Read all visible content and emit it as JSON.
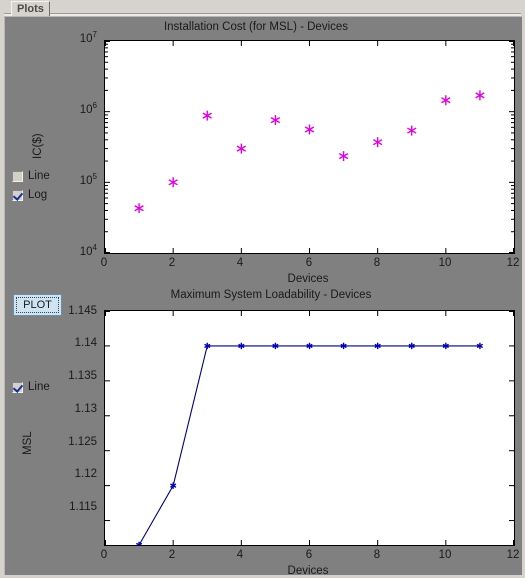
{
  "window": {
    "tab_label": "Plots",
    "background_color": "#808080",
    "frame_color": "#d6d3ce"
  },
  "controls": {
    "top": [
      {
        "name": "line",
        "label": "Line",
        "checked": false
      },
      {
        "name": "log",
        "label": "Log",
        "checked": true
      }
    ],
    "bottom": [
      {
        "name": "line",
        "label": "Line",
        "checked": true
      }
    ],
    "plot_button_label": "PLOT"
  },
  "chart_data": [
    {
      "id": "installation-cost",
      "type": "scatter",
      "title": "Installation Cost (for MSL) - Devices",
      "xlabel": "Devices",
      "ylabel": "IC($)",
      "yscale": "log",
      "xlim": [
        0,
        12
      ],
      "ylim": [
        10000,
        10000000
      ],
      "xticks": [
        0,
        2,
        4,
        6,
        8,
        10,
        12
      ],
      "xtick_labels": [
        "0",
        "2",
        "4",
        "6",
        "8",
        "10",
        "12"
      ],
      "yticks": [
        10000,
        100000,
        1000000,
        10000000
      ],
      "ytick_labels": [
        "10⁴",
        "10⁵",
        "10⁶",
        "10⁷"
      ],
      "ytick_bases": [
        "10",
        "10",
        "10",
        "10"
      ],
      "ytick_exps": [
        "4",
        "5",
        "6",
        "7"
      ],
      "grid": false,
      "legend": null,
      "marker": "star",
      "marker_color": "#e000e0",
      "line_color": "#e000e0",
      "line_visible": false,
      "x": [
        1,
        2,
        3,
        4,
        5,
        6,
        7,
        8,
        9,
        10,
        11
      ],
      "values": [
        43000,
        100000,
        880000,
        300000,
        760000,
        560000,
        235000,
        370000,
        540000,
        1450000,
        1700000
      ]
    },
    {
      "id": "maximum-system-loadability",
      "type": "line",
      "title": "Maximum System Loadability - Devices",
      "xlabel": "Devices",
      "ylabel": "MSL",
      "yscale": "linear",
      "xlim": [
        0,
        12
      ],
      "ylim": [
        1.1115,
        1.145
      ],
      "xticks": [
        0,
        2,
        4,
        6,
        8,
        10,
        12
      ],
      "xtick_labels": [
        "0",
        "2",
        "4",
        "6",
        "8",
        "10",
        "12"
      ],
      "yticks": [
        1.115,
        1.12,
        1.125,
        1.13,
        1.135,
        1.14,
        1.145
      ],
      "ytick_labels": [
        "1.115",
        "1.12",
        "1.125",
        "1.13",
        "1.135",
        "1.14",
        "1.145"
      ],
      "grid": false,
      "legend": null,
      "marker": "star",
      "marker_color": "#0000bb",
      "line_color": "#00007f",
      "line_visible": true,
      "x": [
        1,
        2,
        3,
        4,
        5,
        6,
        7,
        8,
        9,
        10,
        11
      ],
      "values": [
        1.1115,
        1.12,
        1.14,
        1.14,
        1.14,
        1.14,
        1.14,
        1.14,
        1.14,
        1.14,
        1.14
      ]
    }
  ]
}
